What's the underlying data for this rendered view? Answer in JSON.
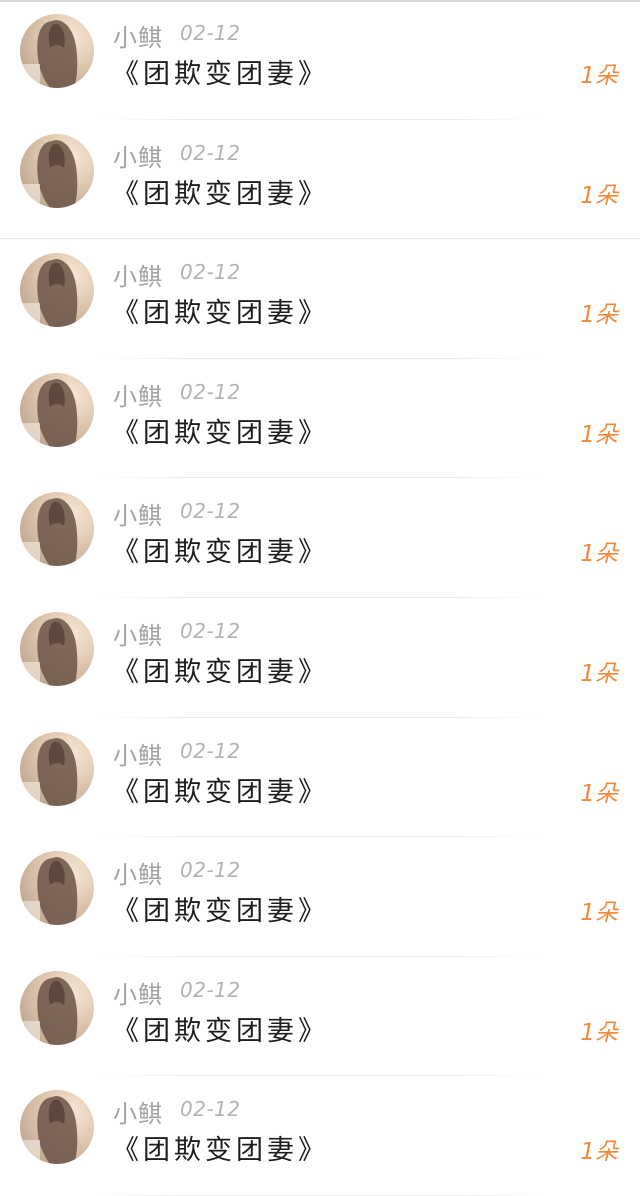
{
  "feed": {
    "items": [
      {
        "user": "小鲯",
        "date": "02-12",
        "title": "《团欺变团妻》",
        "gift": "1朵"
      },
      {
        "user": "小鲯",
        "date": "02-12",
        "title": "《团欺变团妻》",
        "gift": "1朵"
      },
      {
        "user": "小鲯",
        "date": "02-12",
        "title": "《团欺变团妻》",
        "gift": "1朵"
      },
      {
        "user": "小鲯",
        "date": "02-12",
        "title": "《团欺变团妻》",
        "gift": "1朵"
      },
      {
        "user": "小鲯",
        "date": "02-12",
        "title": "《团欺变团妻》",
        "gift": "1朵"
      },
      {
        "user": "小鲯",
        "date": "02-12",
        "title": "《团欺变团妻》",
        "gift": "1朵"
      },
      {
        "user": "小鲯",
        "date": "02-12",
        "title": "《团欺变团妻》",
        "gift": "1朵"
      },
      {
        "user": "小鲯",
        "date": "02-12",
        "title": "《团欺变团妻》",
        "gift": "1朵"
      },
      {
        "user": "小鲯",
        "date": "02-12",
        "title": "《团欺变团妻》",
        "gift": "1朵"
      },
      {
        "user": "小鲯",
        "date": "02-12",
        "title": "《团欺变团妻》",
        "gift": "1朵"
      }
    ]
  },
  "colors": {
    "name": "#a3a3a3",
    "date": "#b4b4b4",
    "title": "#1e1e1e",
    "gift": "#f08a3c"
  }
}
